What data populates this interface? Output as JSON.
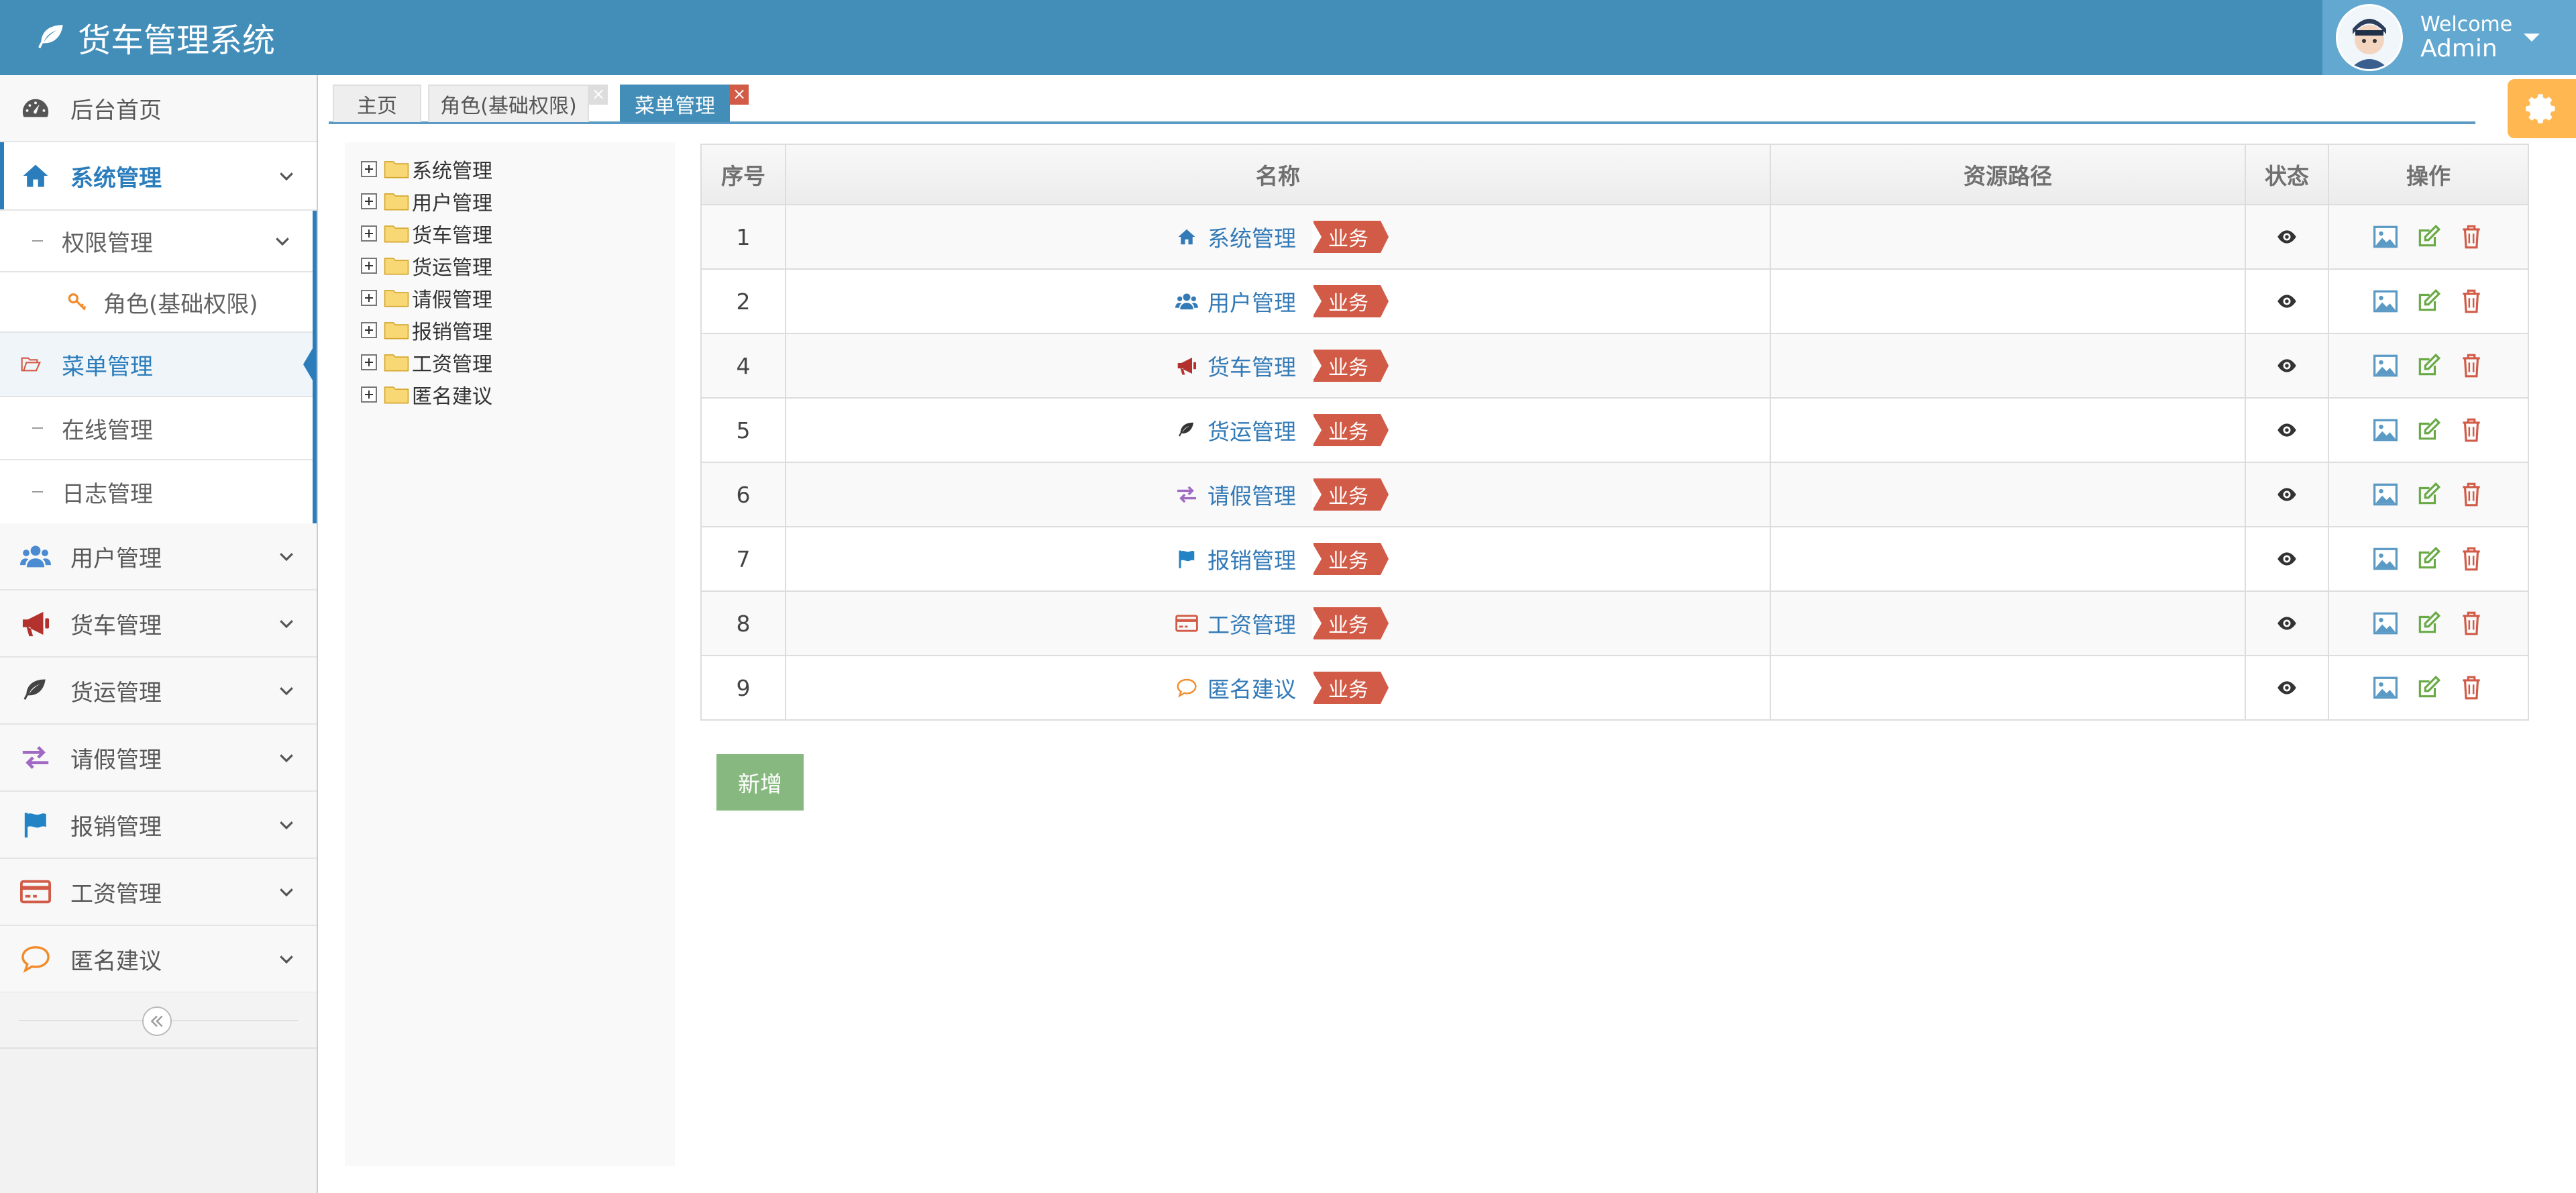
{
  "header": {
    "app_title": "货车管理系统",
    "welcome_label": "Welcome",
    "user_name": "Admin"
  },
  "sidebar": {
    "home": "后台首页",
    "system": "系统管理",
    "perm": "权限管理",
    "role": "角色(基础权限)",
    "menu": "菜单管理",
    "online": "在线管理",
    "log": "日志管理",
    "user": "用户管理",
    "truck": "货车管理",
    "freight": "货运管理",
    "leave": "请假管理",
    "reimburse": "报销管理",
    "salary": "工资管理",
    "suggest": "匿名建议"
  },
  "tabs": [
    {
      "label": "主页"
    },
    {
      "label": "角色(基础权限)"
    },
    {
      "label": "菜单管理"
    }
  ],
  "tree": [
    "系统管理",
    "用户管理",
    "货车管理",
    "货运管理",
    "请假管理",
    "报销管理",
    "工资管理",
    "匿名建议"
  ],
  "table": {
    "headers": [
      "序号",
      "名称",
      "资源路径",
      "状态",
      "操作"
    ],
    "tag": "业务",
    "rows": [
      {
        "seq": "1",
        "name": "系统管理",
        "path": ""
      },
      {
        "seq": "2",
        "name": "用户管理",
        "path": ""
      },
      {
        "seq": "4",
        "name": "货车管理",
        "path": ""
      },
      {
        "seq": "5",
        "name": "货运管理",
        "path": ""
      },
      {
        "seq": "6",
        "name": "请假管理",
        "path": ""
      },
      {
        "seq": "7",
        "name": "报销管理",
        "path": ""
      },
      {
        "seq": "8",
        "name": "工资管理",
        "path": ""
      },
      {
        "seq": "9",
        "name": "匿名建议",
        "path": ""
      }
    ]
  },
  "add_button": "新增",
  "colors": {
    "header": "#438eb9",
    "accent": "#2b7dbc",
    "tag": "#d15b47",
    "add_button": "#87b87f",
    "gear": "#ffb752"
  }
}
